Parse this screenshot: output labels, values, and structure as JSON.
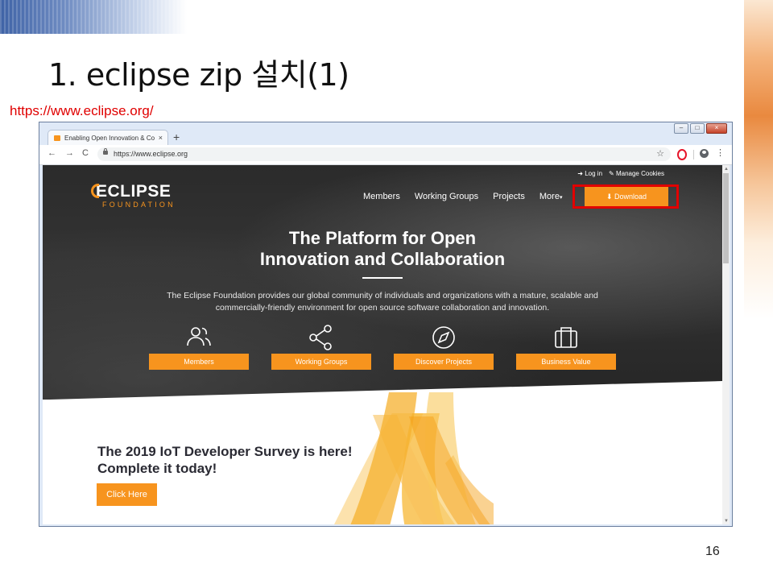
{
  "slide": {
    "title": "1. eclipse zip 설치(1)",
    "url_label": "https://www.eclipse.org/",
    "page_number": "16"
  },
  "browser": {
    "tab_title": "Enabling Open Innovation & Co",
    "tab_close": "×",
    "new_tab": "+",
    "address": "https://www.eclipse.org",
    "back": "←",
    "forward": "→",
    "reload": "C",
    "star": "☆",
    "menu": "⋮",
    "win_min": "–",
    "win_max": "□",
    "win_close": "×"
  },
  "site": {
    "top_links": [
      "Log in",
      "Manage Cookies"
    ],
    "logo_main": "ECLIPSE",
    "logo_sub": "FOUNDATION",
    "nav": [
      "Members",
      "Working Groups",
      "Projects",
      "More"
    ],
    "download_label": "Download",
    "hero_title_line1": "The Platform for Open",
    "hero_title_line2": "Innovation and Collaboration",
    "hero_desc": "The Eclipse Foundation provides our global community of individuals and organizations with a mature, scalable and commercially-friendly environment for open source software collaboration and innovation.",
    "features": [
      {
        "label": "Members",
        "icon": "users-icon"
      },
      {
        "label": "Working Groups",
        "icon": "share-icon"
      },
      {
        "label": "Discover Projects",
        "icon": "compass-icon"
      },
      {
        "label": "Business Value",
        "icon": "briefcase-icon"
      }
    ],
    "survey_line1": "The 2019 IoT Developer Survey is here!",
    "survey_line2": "Complete it today!",
    "click_here": "Click Here"
  },
  "colors": {
    "accent": "#f7941e",
    "highlight": "#e10000",
    "hero_bg": "#2b2b2b"
  }
}
